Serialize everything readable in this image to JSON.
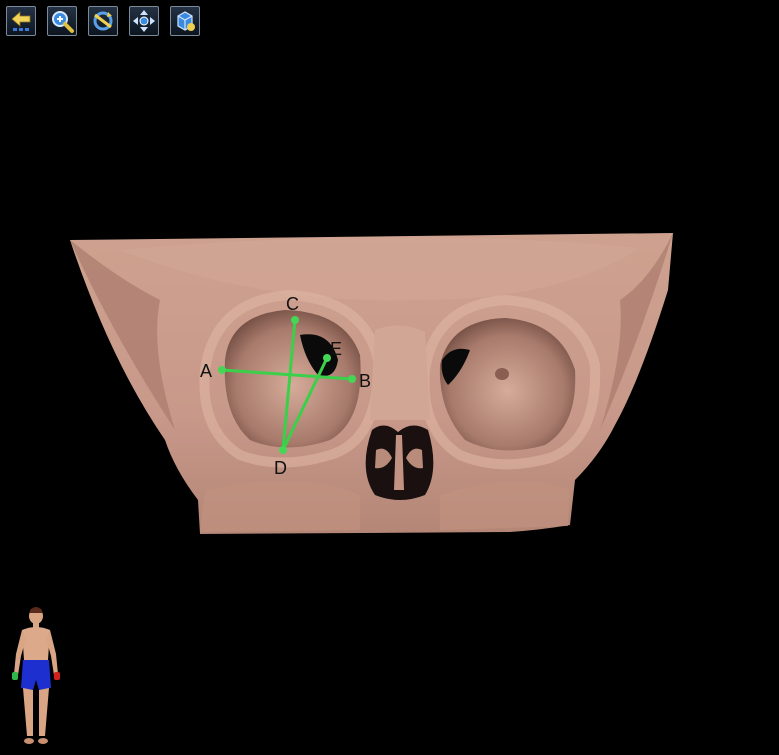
{
  "toolbar": {
    "buttons": [
      {
        "icon": "back-arrow-icon",
        "tooltip": ""
      },
      {
        "icon": "zoom-icon",
        "tooltip": ""
      },
      {
        "icon": "rotate-icon",
        "tooltip": ""
      },
      {
        "icon": "pan-icon",
        "tooltip": ""
      },
      {
        "icon": "reset-view-icon",
        "tooltip": ""
      }
    ]
  },
  "viewport": {
    "model": "skull-3d",
    "skull_color": "#cfa290",
    "line_color": "#3ad04a",
    "landmarks": [
      {
        "label": "A"
      },
      {
        "label": "B"
      },
      {
        "label": "C"
      },
      {
        "label": "D"
      },
      {
        "label": "E"
      }
    ]
  },
  "orientation_figure": {
    "icon": "human-figure-icon"
  }
}
